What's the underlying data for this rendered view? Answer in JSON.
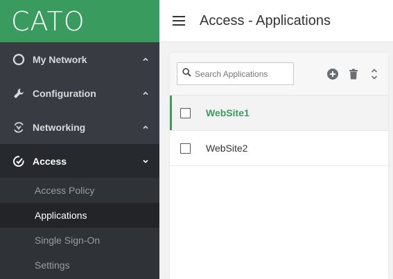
{
  "brand": {
    "logo_text": "CATO",
    "color": "#3a9b5f"
  },
  "sidebar": {
    "sections": [
      {
        "label": "My Network",
        "icon": "circle-icon",
        "expanded": false
      },
      {
        "label": "Configuration",
        "icon": "wrench-icon",
        "expanded": false
      },
      {
        "label": "Networking",
        "icon": "networking-icon",
        "expanded": false
      },
      {
        "label": "Access",
        "icon": "access-icon",
        "expanded": true
      }
    ],
    "access_items": [
      {
        "label": "Access Policy",
        "selected": false
      },
      {
        "label": "Applications",
        "selected": true
      },
      {
        "label": "Single Sign-On",
        "selected": false
      },
      {
        "label": "Settings",
        "selected": false
      }
    ]
  },
  "header": {
    "title": "Access - Applications",
    "menu_icon": "hamburger-icon"
  },
  "panel": {
    "search": {
      "placeholder": "Search Applications",
      "value": ""
    },
    "toolbar_icons": [
      "add-icon",
      "trash-icon",
      "sort-icon"
    ],
    "rows": [
      {
        "label": "WebSite1",
        "selected": true,
        "checked": false
      },
      {
        "label": "WebSite2",
        "selected": false,
        "checked": false
      }
    ]
  }
}
